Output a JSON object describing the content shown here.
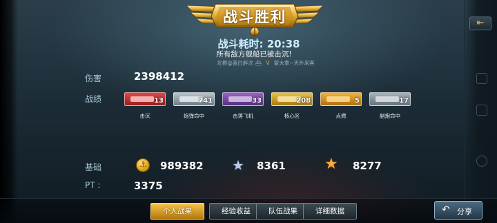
{
  "title": "战斗胜利",
  "battle": {
    "time_label": "战斗耗时:",
    "time_value": "20:38",
    "message": "所有敌方舰船已被击沉!",
    "player_left": "北栀@蓝白胖次",
    "vs": "V",
    "player_right": "蒙大拿~天外来客"
  },
  "stats": {
    "damage_label": "伤害",
    "damage_value": "2398412",
    "record_label": "战绩",
    "base_label": "基础",
    "pt_label": "PT :",
    "pt_value": "3375"
  },
  "achievements": [
    {
      "caption": "击沉",
      "count": "13",
      "color": "red",
      "icon": "warship-icon"
    },
    {
      "caption": "炮弹命中",
      "count": "741",
      "color": "silver",
      "icon": "cannon-icon"
    },
    {
      "caption": "击落飞机",
      "count": "33",
      "color": "purple",
      "icon": "aircraft-icon"
    },
    {
      "caption": "核心区",
      "count": "208",
      "color": "yellow",
      "icon": "citadel-icon"
    },
    {
      "caption": "点燃",
      "count": "5",
      "color": "gold",
      "icon": "fire-icon"
    },
    {
      "caption": "副炮命中",
      "count": "17",
      "color": "gray",
      "icon": "secondary-gun-icon"
    }
  ],
  "rewards": [
    {
      "icon": "coin-icon",
      "value": "989382"
    },
    {
      "icon": "silver-star-icon",
      "value": "8361"
    },
    {
      "icon": "gold-star-icon",
      "value": "8277"
    }
  ],
  "tabs": [
    {
      "label": "个人战果",
      "active": true
    },
    {
      "label": "经验收益",
      "active": false
    },
    {
      "label": "队伍战果",
      "active": false
    },
    {
      "label": "详细数据",
      "active": false
    }
  ],
  "share": {
    "label": "分享",
    "icon": "share-arrow-icon"
  },
  "close": {
    "label": "⇤",
    "icon": "back-icon"
  },
  "colors": {
    "accent_gold": "#f5c24a",
    "label_blue": "#a9c7d8"
  }
}
